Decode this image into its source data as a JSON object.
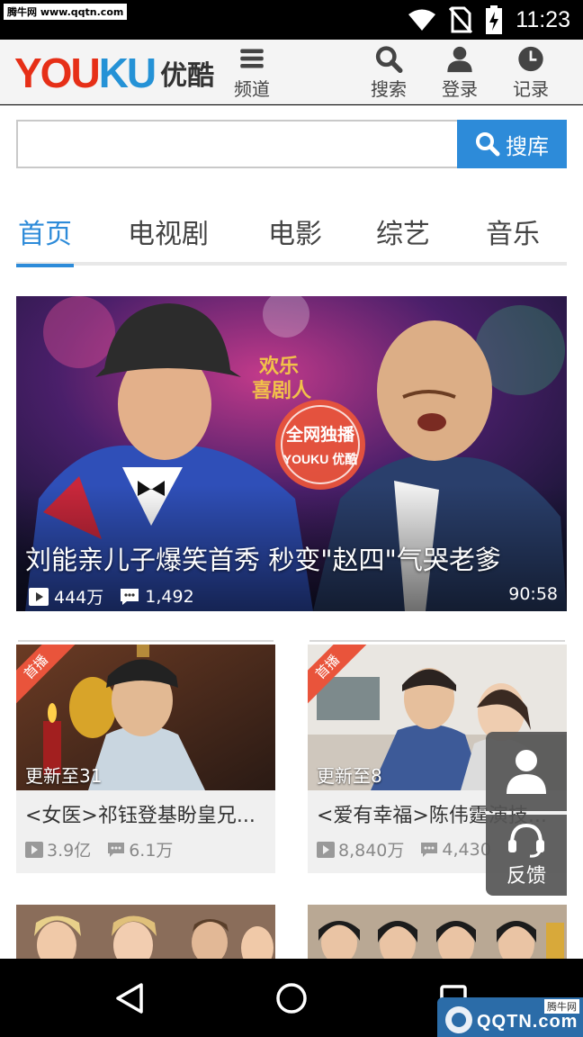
{
  "status": {
    "watermark": "腾牛网 www.qqtn.com",
    "time": "11:23"
  },
  "header": {
    "logo_en": "YOUKU",
    "logo_cn": "优酷",
    "channels_label": "频道",
    "search_label": "搜索",
    "login_label": "登录",
    "history_label": "记录"
  },
  "search": {
    "placeholder": "",
    "button_label": "搜库"
  },
  "tabs": [
    {
      "label": "首页",
      "active": true
    },
    {
      "label": "电视剧",
      "active": false
    },
    {
      "label": "电影",
      "active": false
    },
    {
      "label": "综艺",
      "active": false
    },
    {
      "label": "音乐",
      "active": false
    }
  ],
  "hero": {
    "show_logo": "欢乐喜剧人",
    "badge_top": "全网独播",
    "badge_bottom": "YOUKU 优酷",
    "title": "刘能亲儿子爆笑首秀 秒变\"赵四\"气哭老爹",
    "plays": "444万",
    "comments": "1,492",
    "duration": "90:58"
  },
  "cards": [
    {
      "ribbon": "首播",
      "update": "更新至31",
      "title": "<女医>祁钰登基盼皇兄...",
      "plays": "3.9亿",
      "comments": "6.1万"
    },
    {
      "ribbon": "首播",
      "update": "更新至8",
      "title": "<爱有幸福>陈伟霆演技...",
      "plays": "8,840万",
      "comments": "4,430"
    }
  ],
  "floating": {
    "feedback_label": "反馈"
  },
  "watermark_bottom": {
    "small": "腾牛网",
    "brand": "QQTN.com"
  },
  "colors": {
    "accent": "#2d8bd9",
    "logo_red": "#e62f17",
    "logo_blue": "#2592d6",
    "ribbon": "#e9543b"
  }
}
